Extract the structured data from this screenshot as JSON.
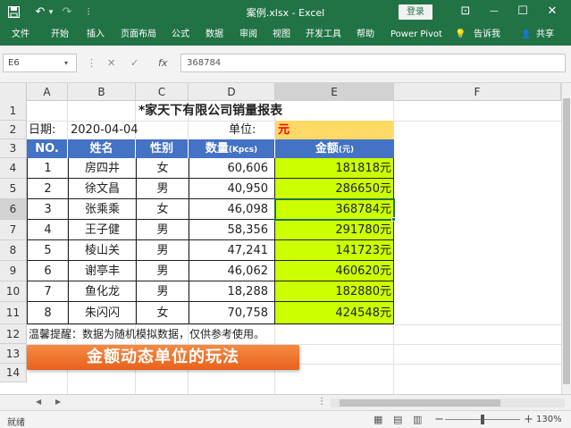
{
  "window": {
    "title": "案例.xlsx  -  Excel",
    "login_label": "登录",
    "restore_glyph": "⊡",
    "minimize_glyph": "—",
    "maximize_glyph": "☐",
    "close_glyph": "✕",
    "accent": "#217346"
  },
  "quick_access": {
    "undo_glyph": "↶",
    "undo_arrow": "▾",
    "redo_glyph": "↷",
    "customize_glyph": "⫶"
  },
  "ribbon": {
    "tabs": [
      "文件",
      "开始",
      "插入",
      "页面布局",
      "公式",
      "数据",
      "审阅",
      "视图",
      "开发工具",
      "帮助",
      "Power Pivot"
    ],
    "tell_me_glyph": "💡",
    "tell_me_label": "告诉我",
    "share_glyph": "👤",
    "share_label": "共享"
  },
  "formula_bar": {
    "name_box": "E6",
    "name_box_arrow": "▾",
    "more_glyph": "⋮",
    "cancel_glyph": "✕",
    "enter_glyph": "✓",
    "fx_label": "fx",
    "value": "368784"
  },
  "columns": [
    "A",
    "B",
    "C",
    "D",
    "E",
    "F"
  ],
  "rows": [
    "1",
    "2",
    "3",
    "4",
    "5",
    "6",
    "7",
    "8",
    "9",
    "10",
    "11",
    "12",
    "13",
    "14"
  ],
  "sheet": {
    "title": "*家天下有限公司销量报表",
    "date_label": "日期:",
    "date_value": "2020-04-04",
    "unit_label": "单位:",
    "unit_value": "元",
    "headers": {
      "no": "NO.",
      "name": "姓名",
      "gender": "性别",
      "qty_main": "数量",
      "qty_unit": "(Kpcs)",
      "amount_main": "金额",
      "amount_unit": "(元)"
    },
    "data_rows": [
      {
        "no": "1",
        "name": "房四井",
        "gender": "女",
        "qty": "60,606",
        "amount": "181818",
        "unit": "元"
      },
      {
        "no": "2",
        "name": "徐文昌",
        "gender": "男",
        "qty": "40,950",
        "amount": "286650",
        "unit": "元"
      },
      {
        "no": "3",
        "name": "张乘乘",
        "gender": "女",
        "qty": "46,098",
        "amount": "368784",
        "unit": "元"
      },
      {
        "no": "4",
        "name": "王子健",
        "gender": "男",
        "qty": "58,356",
        "amount": "291780",
        "unit": "元"
      },
      {
        "no": "5",
        "name": "棱山关",
        "gender": "男",
        "qty": "47,241",
        "amount": "141723",
        "unit": "元"
      },
      {
        "no": "6",
        "name": "谢亭丰",
        "gender": "男",
        "qty": "46,062",
        "amount": "460620",
        "unit": "元"
      },
      {
        "no": "7",
        "name": "鱼化龙",
        "gender": "男",
        "qty": "18,288",
        "amount": "182880",
        "unit": "元"
      },
      {
        "no": "8",
        "name": "朱闪闪",
        "gender": "女",
        "qty": "70,758",
        "amount": "424548",
        "unit": "元"
      }
    ],
    "note": "温馨提醒：数据为随机模拟数据，仅供参考使用。",
    "banner": "金额动态单位的玩法"
  },
  "colors": {
    "header_fill": "#4472c4",
    "unit_fill": "#ffd966",
    "amount_fill": "#ccff00",
    "unit_text": "#ff0000",
    "banner_fill": "#f0742b"
  },
  "sheet_tabs": {
    "prev_glyph": "◀",
    "next_glyph": "▶",
    "more_glyph": "⋮"
  },
  "status": {
    "mode": "就绪",
    "normal_view_glyph": "▦",
    "layout_view_glyph": "▤",
    "break_view_glyph": "▥",
    "zoom_out_glyph": "−",
    "zoom_in_glyph": "+",
    "zoom": "130%"
  }
}
